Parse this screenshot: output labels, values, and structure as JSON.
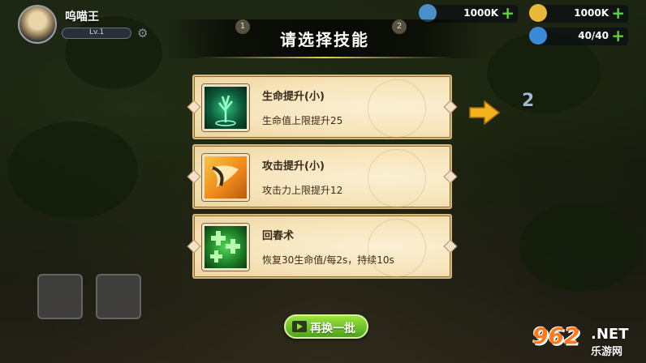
{
  "player": {
    "name": "呜喵王",
    "level": "Lv.1"
  },
  "resources": [
    {
      "icon": "energy-icon",
      "value": "1000K",
      "color": "#4a90c8"
    },
    {
      "icon": "coin-icon",
      "value": "1000K",
      "color": "#e8b83a"
    },
    {
      "icon": "stamina-icon",
      "value": "40/40",
      "color": "#3a8ad8"
    }
  ],
  "dialog": {
    "title": "请选择技能",
    "tab_left": "1",
    "tab_right": "2",
    "page_indicator": "2",
    "refresh_label": "再换一批"
  },
  "skills": [
    {
      "name": "生命提升(小)",
      "desc": "生命值上限提升25",
      "icon": "tree-icon"
    },
    {
      "name": "攻击提升(小)",
      "desc": "攻击力上限提升12",
      "icon": "sword-slash-icon"
    },
    {
      "name": "回春术",
      "desc": "恢复30生命值/每2s，持续10s",
      "icon": "heal-cross-icon"
    }
  ],
  "watermark": {
    "number": "962",
    "suffix": ".NET",
    "site": "乐游网"
  }
}
